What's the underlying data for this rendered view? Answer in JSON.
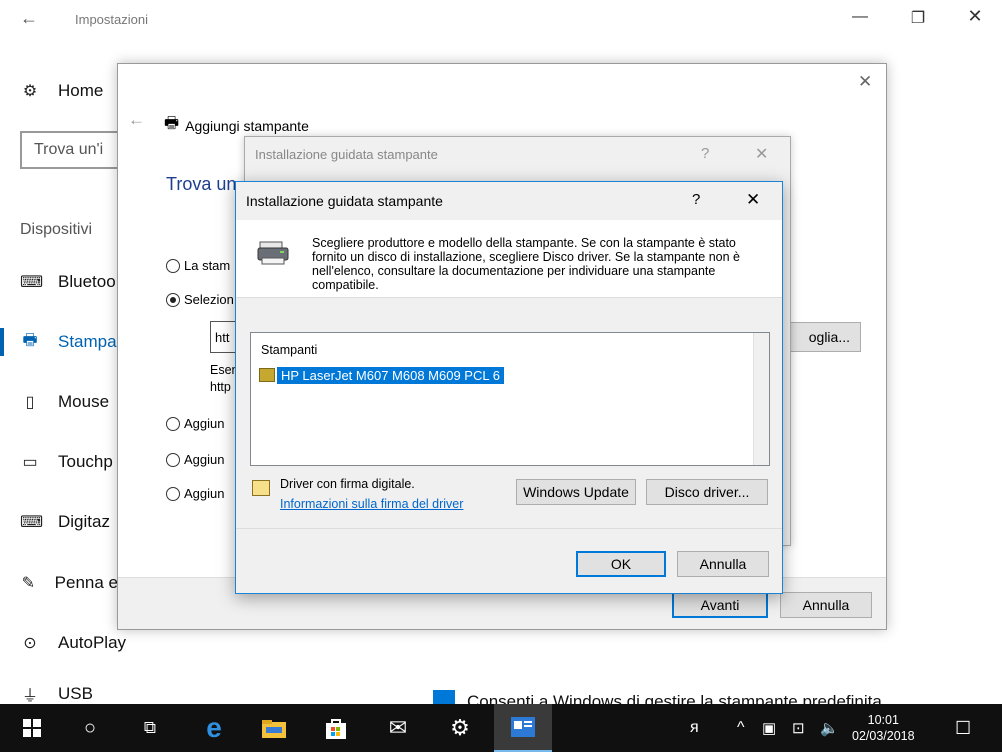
{
  "settings": {
    "title": "Impostazioni",
    "home_label": "Home",
    "search_placeholder": "Trova un'impostazione",
    "search_visible": "Trova un'i",
    "section_label": "Dispositivi",
    "nav": [
      {
        "label": "Bluetooth e altri dispositivi",
        "short": "Bluetoo",
        "icon": "bluetooth-keyboard-icon"
      },
      {
        "label": "Stampanti e scanner",
        "short": "Stampa",
        "icon": "printer-icon"
      },
      {
        "label": "Mouse",
        "short": "Mouse",
        "icon": "mouse-icon"
      },
      {
        "label": "Touchpad",
        "short": "Touchp",
        "icon": "touchpad-icon"
      },
      {
        "label": "Digitazione",
        "short": "Digitaz",
        "icon": "keyboard-icon"
      },
      {
        "label": "Penna e Windows Ink",
        "short": "Penna e",
        "icon": "pen-icon"
      },
      {
        "label": "AutoPlay",
        "short": "AutoPlay",
        "icon": "autoplay-icon"
      },
      {
        "label": "USB",
        "short": "USB",
        "icon": "usb-icon"
      }
    ],
    "default_printer_checkbox": "Consenti a Windows di gestire la stampante predefinita"
  },
  "add_printer": {
    "title": "Aggiungi stampante",
    "heading": "Trova un",
    "options": [
      {
        "label": "La stam",
        "checked": false
      },
      {
        "label": "Selezion",
        "checked": true
      },
      {
        "label": "Aggiun",
        "checked": false
      },
      {
        "label": "Aggiun",
        "checked": false
      },
      {
        "label": "Aggiun",
        "checked": false
      }
    ],
    "url_value": "htt",
    "example_line1": "Esen",
    "example_line2": "http",
    "browse_label": "oglia...",
    "next_label": "Avanti",
    "cancel_label": "Annulla"
  },
  "wizard_back": {
    "title": "Installazione guidata stampante",
    "help": "?",
    "close": "✕"
  },
  "wizard": {
    "title": "Installazione guidata stampante",
    "help": "?",
    "close": "✕",
    "description": "Scegliere produttore e modello della stampante. Se con la stampante è stato fornito un disco di installazione, scegliere Disco driver. Se la stampante non è nell'elenco, consultare la documentazione per individuare una stampante compatibile.",
    "list_header": "Stampanti",
    "printer_item": "HP LaserJet M607 M608 M609 PCL 6",
    "signed_text": "Driver con firma digitale.",
    "signed_link": "Informazioni sulla firma del driver",
    "windows_update_label": "Windows Update",
    "disk_label": "Disco driver...",
    "ok_label": "OK",
    "cancel_label": "Annulla"
  },
  "taskbar": {
    "time": "10:01",
    "date": "02/03/2018"
  }
}
